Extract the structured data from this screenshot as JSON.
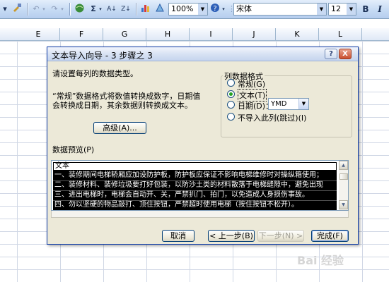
{
  "toolbar": {
    "zoom": "100%",
    "font_name": "宋体",
    "font_size": "12",
    "bold_label": "B",
    "italic_label": "I",
    "icons": [
      "dropdown-icon",
      "format-painter-icon",
      "undo-icon",
      "redo-icon",
      "hyperlink-icon",
      "autosum-icon",
      "sort-ascending-icon",
      "sort-descending-icon",
      "chart-wizard-icon",
      "drawing-icon",
      "help-icon"
    ],
    "autosum_label": "Σ"
  },
  "grid": {
    "columns": [
      "E",
      "F",
      "G",
      "H",
      "I",
      "J",
      "K",
      "L"
    ]
  },
  "dialog": {
    "title": "文本导入向导 - 3 步骤之 3",
    "help_button": "?",
    "close_button": "X",
    "instruction": "请设置每列的数据类型。",
    "description_line1": "“常规”数据格式将数值转换成数字，日期值",
    "description_line2": "会转换成日期，其余数据则转换成文本。",
    "advanced_button": "高级(A)...",
    "column_format": {
      "title": "列数据格式",
      "options": [
        "常规(G)",
        "文本(T)",
        "日期(D)：",
        "不导入此列(跳过)(I)"
      ],
      "selected": "文本(T)",
      "date_format": "YMD"
    },
    "preview": {
      "label": "数据预览(P)",
      "header": "文本",
      "lines": [
        "一、装修期间电梯轿厢应加设防护板，防护板应保证不影响电梯维修时对操纵箱使用；",
        "二、装修材料、装修垃圾要打好包装，以防沙土类的材料散落于电梯缝隙中，避免出现",
        "三、进出电梯时，电梯会自动开、关，严禁扒门、拍门，以免造成人身损伤事故。",
        "四、勿以坚硬的物品敲打、顶住按钮，严禁超时使用电梯（按住按钮不松开）。"
      ]
    },
    "buttons": {
      "cancel": "取消",
      "back": "< 上一步(B)",
      "next": "下一步(N) >",
      "finish": "完成(F)"
    }
  },
  "watermark": "Bai 经验"
}
